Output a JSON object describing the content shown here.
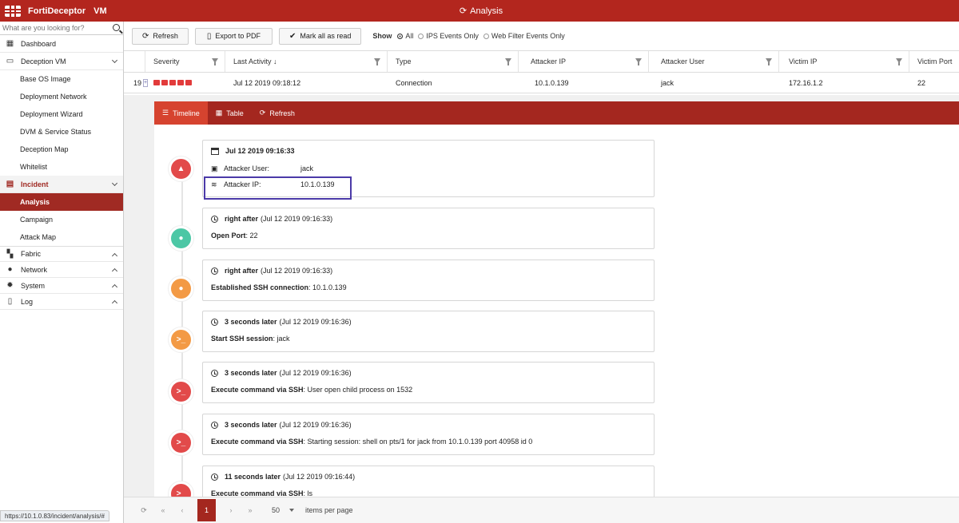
{
  "app": {
    "name": "FortiDeceptor",
    "edition": "VM",
    "page_title": "Analysis"
  },
  "sidebar": {
    "search_placeholder": "What are you looking for?",
    "items": [
      {
        "label": "Dashboard"
      },
      {
        "label": "Deception VM"
      },
      {
        "label": "Base OS Image"
      },
      {
        "label": "Deployment Network"
      },
      {
        "label": "Deployment Wizard"
      },
      {
        "label": "DVM & Service Status"
      },
      {
        "label": "Deception Map"
      },
      {
        "label": "Whitelist"
      },
      {
        "label": "Incident"
      },
      {
        "label": "Analysis"
      },
      {
        "label": "Campaign"
      },
      {
        "label": "Attack Map"
      },
      {
        "label": "Fabric"
      },
      {
        "label": "Network"
      },
      {
        "label": "System"
      },
      {
        "label": "Log"
      }
    ]
  },
  "toolbar": {
    "refresh": "Refresh",
    "export": "Export to PDF",
    "mark_read": "Mark all as read",
    "show_label": "Show",
    "opt_all": "All",
    "opt_ips": "IPS Events Only",
    "opt_web": "Web Filter Events Only"
  },
  "table": {
    "columns": [
      "Severity",
      "Last Activity ↓",
      "Type",
      "Attacker IP",
      "Attacker User",
      "Victim IP",
      "Victim Port"
    ],
    "row": {
      "index": "19",
      "last_activity": "Jul 12 2019 09:18:12",
      "type": "Connection",
      "attacker_ip": "10.1.0.139",
      "attacker_user": "jack",
      "victim_ip": "172.16.1.2",
      "victim_port": "22"
    }
  },
  "detail_tabs": {
    "timeline": "Timeline",
    "table": "Table",
    "refresh": "Refresh"
  },
  "timeline": [
    {
      "time": "Jul 12 2019 09:16:33",
      "user_label": "Attacker User:",
      "user": "jack",
      "ip_label": "Attacker IP:",
      "ip": "10.1.0.139",
      "color": "#e24a4a"
    },
    {
      "when": "right after",
      "time": "(Jul 12 2019 09:16:33)",
      "label": "Open Port",
      "value": ": 22",
      "color": "#4cc7a5"
    },
    {
      "when": "right after",
      "time": "(Jul 12 2019 09:16:33)",
      "label": "Established SSH connection",
      "value": ": 10.1.0.139",
      "color": "#f39a45"
    },
    {
      "when": "3 seconds later",
      "time": "(Jul 12 2019 09:16:36)",
      "label": "Start SSH session",
      "value": ": jack",
      "color": "#f39a45"
    },
    {
      "when": "3 seconds later",
      "time": "(Jul 12 2019 09:16:36)",
      "label": "Execute command via SSH",
      "value": ": User open child process on 1532",
      "color": "#e24a4a"
    },
    {
      "when": "3 seconds later",
      "time": "(Jul 12 2019 09:16:36)",
      "label": "Execute command via SSH",
      "value": ": Starting session: shell on pts/1 for jack from 10.1.0.139 port 40958 id 0",
      "color": "#e24a4a"
    },
    {
      "when": "11 seconds later",
      "time": "(Jul 12 2019 09:16:44)",
      "label": "Execute command via SSH",
      "value": ": ls",
      "color": "#e24a4a"
    }
  ],
  "pager": {
    "current": "1",
    "page_size": "50",
    "per_page_label": "items per page"
  },
  "status_url": "https://10.1.0.83/incident/analysis/#"
}
